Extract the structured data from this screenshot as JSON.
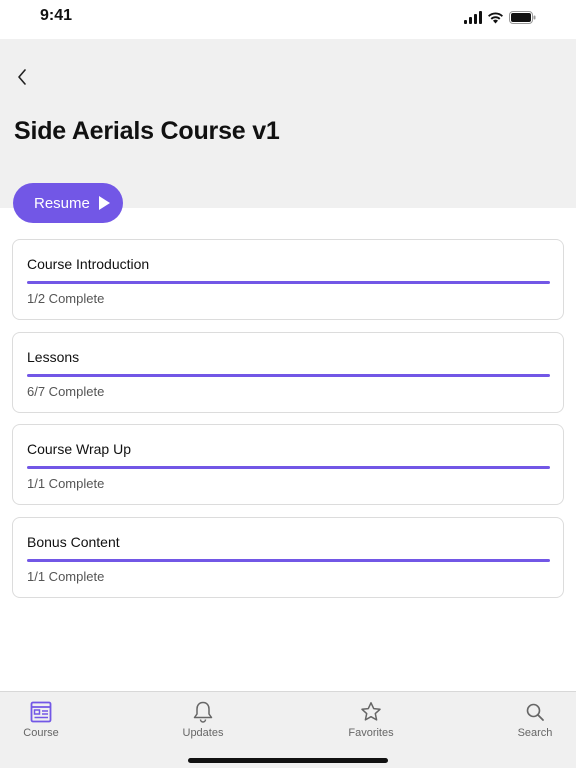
{
  "status_bar": {
    "time": "9:41"
  },
  "header": {
    "title": "Side Aerials Course v1",
    "back_icon": "chevron-left-icon"
  },
  "resume": {
    "label": "Resume",
    "icon": "play-icon"
  },
  "colors": {
    "accent": "#7257e6",
    "header_bg": "#f0f0f0",
    "card_border": "#dcdcdc"
  },
  "sections": [
    {
      "title": "Course Introduction",
      "status": "1/2 Complete",
      "progress": 1.0
    },
    {
      "title": "Lessons",
      "status": "6/7 Complete",
      "progress": 1.0
    },
    {
      "title": "Course Wrap Up",
      "status": "1/1 Complete",
      "progress": 1.0
    },
    {
      "title": "Bonus Content",
      "status": "1/1 Complete",
      "progress": 1.0
    }
  ],
  "tab_bar": {
    "tabs": [
      {
        "label": "Course",
        "icon": "course-icon",
        "active": true
      },
      {
        "label": "Updates",
        "icon": "bell-icon",
        "active": false
      },
      {
        "label": "Favorites",
        "icon": "star-icon",
        "active": false
      },
      {
        "label": "Search",
        "icon": "search-icon",
        "active": false
      }
    ]
  }
}
